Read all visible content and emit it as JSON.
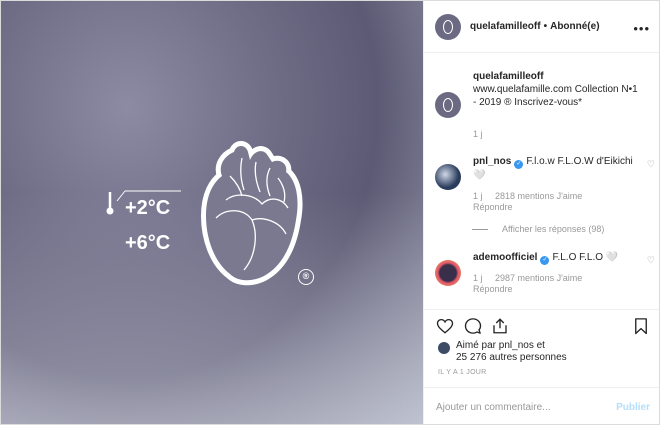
{
  "media": {
    "temp_high": "+2°C",
    "temp_low": "+6°C",
    "registered_mark": "®"
  },
  "header": {
    "username": "quelafamilleoff",
    "separator": "•",
    "follow_status": "Abonné(e)"
  },
  "caption": {
    "username": "quelafamilleoff",
    "text": "www.quelafamille.com Collection N•1 - 2019 ® Inscrivez-vous*",
    "time": "1 j"
  },
  "comments": [
    {
      "username": "pnl_nos",
      "text": "F.l.o.w F.L.O.W d'Eikichi 🤍",
      "time": "1 j",
      "likes": "2818 mentions J'aime",
      "reply": "Répondre",
      "avatar_color": "#2a3c5c"
    },
    {
      "username": "ademoofficiel",
      "text": "F.L.O F.L.O 🤍",
      "time": "1 j",
      "likes": "2987 mentions J'aime",
      "reply": "Répondre",
      "avatar_color": "#7a2b3a"
    }
  ],
  "view_replies": "Afficher les réponses (98)",
  "liked_by": {
    "line1": "Aimé par pnl_nos et",
    "line2": "25 276 autres personnes"
  },
  "date": "IL Y A 1 JOUR",
  "comment_input": {
    "placeholder": "Ajouter un commentaire...",
    "publish": "Publier"
  },
  "colors": {
    "accent": "#3897f0",
    "publish_disabled": "#b2dffc"
  }
}
